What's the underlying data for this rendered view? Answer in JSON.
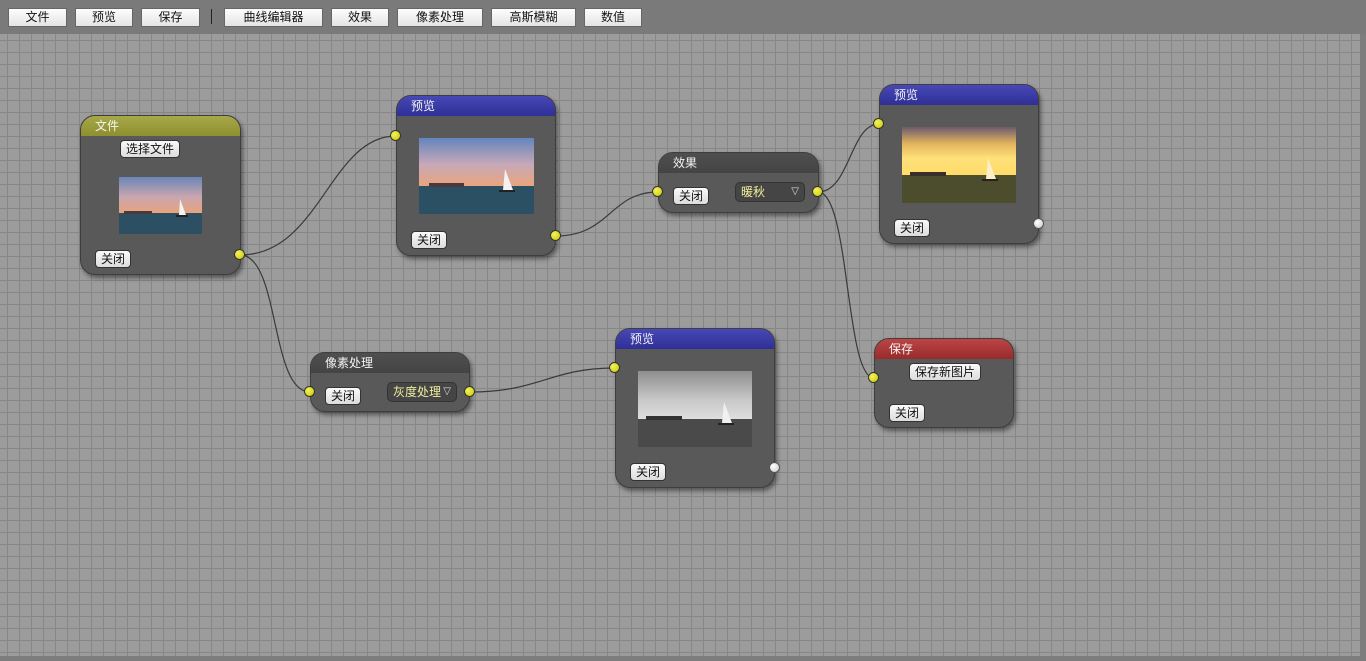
{
  "toolbar": {
    "file": "文件",
    "preview": "预览",
    "save": "保存",
    "curve_editor": "曲线编辑器",
    "effect": "效果",
    "pixel_process": "像素处理",
    "gaussian_blur": "高斯模糊",
    "value": "数值"
  },
  "nodes": {
    "file": {
      "title": "文件",
      "select_file": "选择文件",
      "close": "关闭"
    },
    "preview_original": {
      "title": "预览",
      "close": "关闭"
    },
    "effect": {
      "title": "效果",
      "close": "关闭",
      "selected": "暖秋"
    },
    "preview_warm": {
      "title": "预览",
      "close": "关闭"
    },
    "pixel": {
      "title": "像素处理",
      "close": "关闭",
      "selected": "灰度处理"
    },
    "preview_gray": {
      "title": "预览",
      "close": "关闭"
    },
    "save": {
      "title": "保存",
      "save_new": "保存新图片",
      "close": "关闭"
    }
  },
  "colors": {
    "header_file": "#9a9b3a",
    "header_preview": "#3a3aa6",
    "header_save": "#a83737",
    "port_connected": "#dada10",
    "port_free": "#e0e0e0"
  },
  "icons": {
    "dropdown": "dropdown-arrow-icon"
  }
}
